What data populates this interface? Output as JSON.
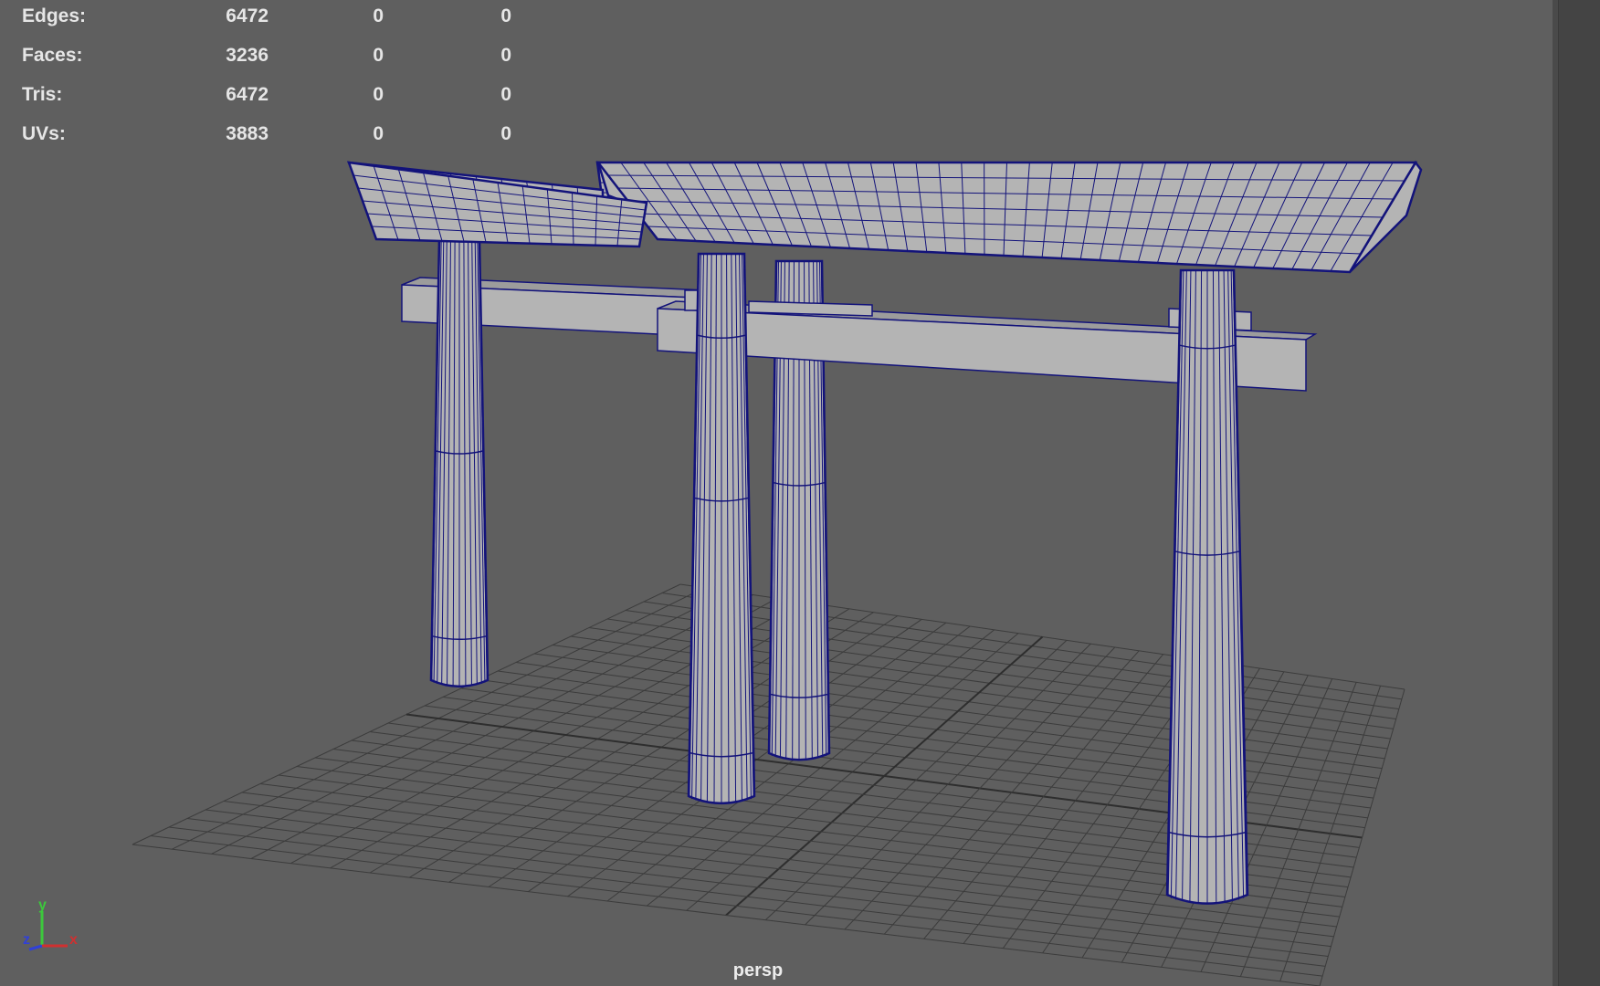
{
  "hud": {
    "rows": [
      {
        "label": "Edges:",
        "v1": "6472",
        "v2": "0",
        "v3": "0"
      },
      {
        "label": "Faces:",
        "v1": "3236",
        "v2": "0",
        "v3": "0"
      },
      {
        "label": "Tris:",
        "v1": "6472",
        "v2": "0",
        "v3": "0"
      },
      {
        "label": "UVs:",
        "v1": "3883",
        "v2": "0",
        "v3": "0"
      }
    ]
  },
  "viewport": {
    "camera": "persp",
    "model": "torii-gate",
    "wireframe_color": "#13137a",
    "shaded_color": "#b4b4b4",
    "grid_color": "#3c3c3c",
    "background_color": "#5f5f5f"
  },
  "axis_gizmo": {
    "x": "x",
    "y": "y",
    "z": "z",
    "x_color": "#d03030",
    "y_color": "#3cc83c",
    "z_color": "#3040d8"
  }
}
